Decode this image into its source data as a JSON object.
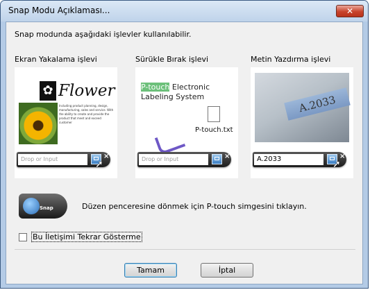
{
  "window": {
    "title": "Snap Modu Açıklaması...",
    "close_glyph": "✕"
  },
  "intro_text": "Snap modunda aşağıdaki işlevler kullanılabilir.",
  "sections": [
    {
      "label": "Ekran Yakalama işlevi",
      "input_placeholder": "Drop or Input",
      "flower_word": "Flower",
      "flower_text": "Including product planning, design, manufacturing, sales and service. With the ability to create and provide the product that meet and exceed customer"
    },
    {
      "label": "Sürükle Bırak işlevi",
      "input_placeholder": "Drop or Input",
      "text_highlight": "P-touch",
      "text_rest1": " Electronic",
      "text_line2": "Labeling System",
      "file_name": "P-touch.txt"
    },
    {
      "label": "Metin Yazdırma işlevi",
      "input_value": "A.2033",
      "tape_text": "A.2033"
    }
  ],
  "snap_icon_label": "Snap",
  "snap_description": "Düzen penceresine dönmek için P-touch simgesini tıklayın.",
  "checkbox": {
    "label": "Bu İletişimi Tekrar Gösterme",
    "checked": false
  },
  "buttons": {
    "ok": "Tamam",
    "cancel": "İptal"
  },
  "colors": {
    "title_bar": "#c9dbee",
    "close": "#c8432b",
    "highlight": "#6cc07a",
    "arrow": "#6e58c6"
  }
}
